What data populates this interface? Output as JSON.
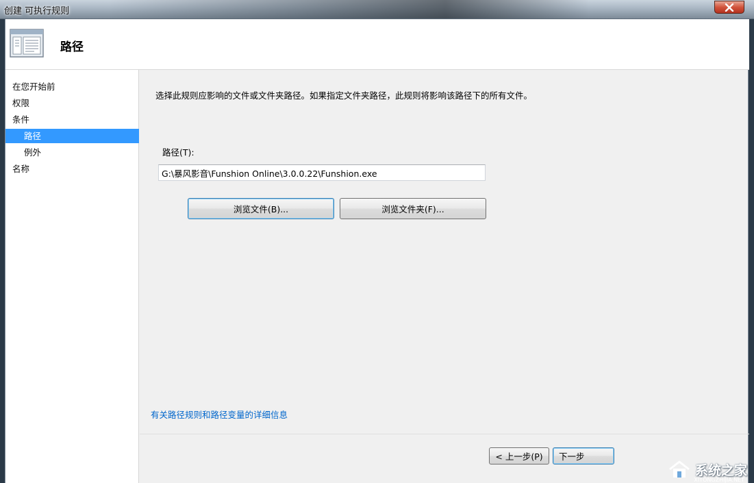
{
  "window": {
    "title": "创建 可执行规则",
    "close_icon": "close-icon"
  },
  "header": {
    "title": "路径",
    "icon": "wizard-page-icon"
  },
  "sidebar": {
    "items": [
      {
        "label": "在您开始前",
        "level": 0,
        "selected": false
      },
      {
        "label": "权限",
        "level": 0,
        "selected": false
      },
      {
        "label": "条件",
        "level": 0,
        "selected": false
      },
      {
        "label": "路径",
        "level": 1,
        "selected": true
      },
      {
        "label": "例外",
        "level": 1,
        "selected": false
      },
      {
        "label": "名称",
        "level": 0,
        "selected": false
      }
    ]
  },
  "main": {
    "description": "选择此规则应影响的文件或文件夹路径。如果指定文件夹路径，此规则将影响该路径下的所有文件。",
    "path_label": "路径(T):",
    "path_value": "G:\\暴风影音\\Funshion Online\\3.0.0.22\\Funshion.exe",
    "browse_file_label": "浏览文件(B)...",
    "browse_folder_label": "浏览文件夹(F)...",
    "help_link": "有关路径规则和路径变量的详细信息"
  },
  "footer": {
    "back_label": "< 上一步(P)",
    "next_label": "下一步"
  },
  "watermark": {
    "text": "系统之家",
    "site": "XITONGZHIJIA.NET"
  },
  "colors": {
    "selection": "#3399ff",
    "link": "#0066cc",
    "close_button": "#c9472f"
  }
}
